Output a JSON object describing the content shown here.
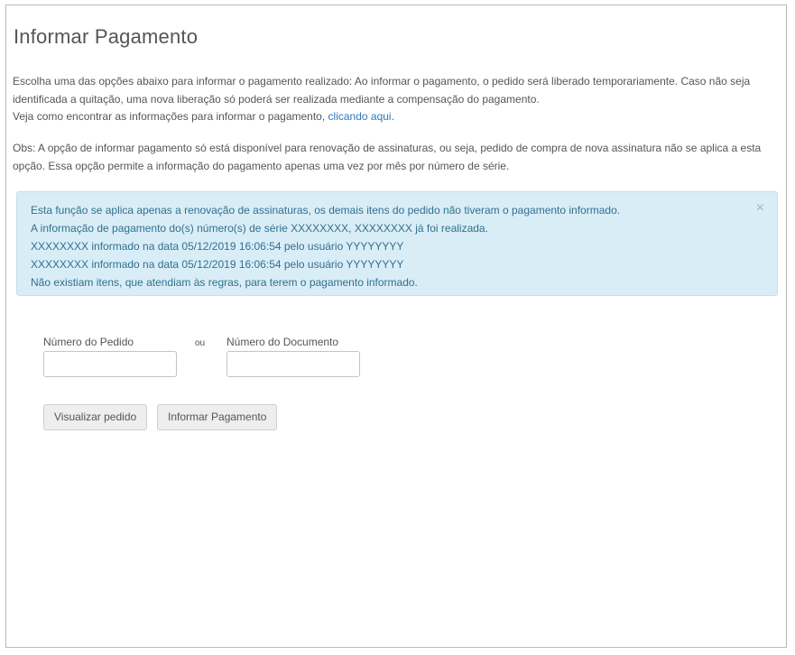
{
  "page": {
    "title": "Informar Pagamento",
    "intro": {
      "line1": "Escolha uma das opções abaixo para informar o pagamento realizado: Ao informar o pagamento, o pedido será liberado temporariamente. Caso não seja identificada a quitação, uma nova liberação só poderá ser realizada mediante a compensação do pagamento.",
      "line2_prefix": "Veja como encontrar as informações para informar o pagamento, ",
      "link_text": "clicando aqui",
      "line2_suffix": "."
    },
    "obs": "Obs: A opção de informar pagamento só está disponível para renovação de assinaturas, ou seja, pedido de compra de nova assinatura não se aplica a esta opção. Essa opção permite a informação do pagamento apenas uma vez por mês por número de série."
  },
  "alert": {
    "lines": [
      "Esta função se aplica apenas a renovação de assinaturas, os demais itens do pedido não tiveram o pagamento informado.",
      "A informação de pagamento do(s) número(s) de série XXXXXXXX, XXXXXXXX já foi realizada.",
      "XXXXXXXX informado na data 05/12/2019 16:06:54 pelo usuário YYYYYYYY",
      "XXXXXXXX informado na data 05/12/2019 16:06:54 pelo usuário YYYYYYYY",
      "Não existiam itens, que atendiam às regras, para terem o pagamento informado."
    ],
    "close_glyph": "×",
    "color": "#31708f",
    "background": "#d9edf7"
  },
  "form": {
    "order_label": "Número do Pedido",
    "or_label": "ou",
    "document_label": "Número do Documento",
    "order_value": "",
    "document_value": "",
    "view_order_button": "Visualizar pedido",
    "inform_payment_button": "Informar Pagamento"
  },
  "colors": {
    "text": "#555555",
    "link": "#2e79b9"
  },
  "icons": {
    "close": "close-icon"
  }
}
